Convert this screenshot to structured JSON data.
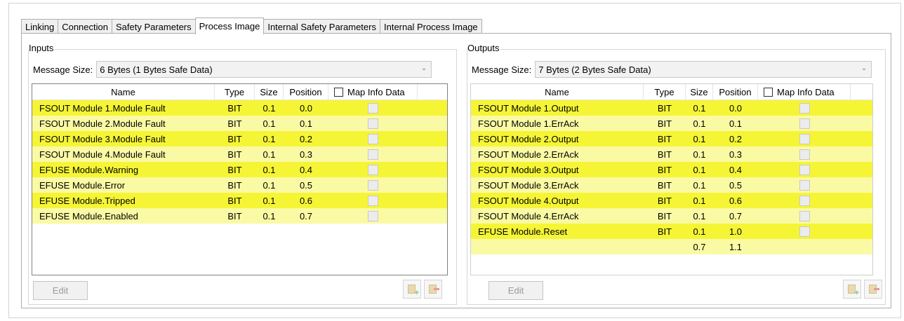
{
  "tabs": [
    "Linking",
    "Connection",
    "Safety Parameters",
    "Process Image",
    "Internal Safety Parameters",
    "Internal Process Image"
  ],
  "active_tab": "Process Image",
  "inputs": {
    "title": "Inputs",
    "message_size_label": "Message Size:",
    "message_size_value": "6 Bytes (1 Bytes Safe Data)",
    "columns": {
      "name": "Name",
      "type": "Type",
      "size": "Size",
      "position": "Position",
      "map_info": "Map Info Data"
    },
    "rows": [
      {
        "name": "FSOUT Module 1.Module Fault",
        "type": "BIT",
        "size": "0.1",
        "position": "0.0"
      },
      {
        "name": "FSOUT Module 2.Module Fault",
        "type": "BIT",
        "size": "0.1",
        "position": "0.1"
      },
      {
        "name": "FSOUT Module 3.Module Fault",
        "type": "BIT",
        "size": "0.1",
        "position": "0.2"
      },
      {
        "name": "FSOUT Module 4.Module Fault",
        "type": "BIT",
        "size": "0.1",
        "position": "0.3"
      },
      {
        "name": "EFUSE Module.Warning",
        "type": "BIT",
        "size": "0.1",
        "position": "0.4"
      },
      {
        "name": "EFUSE Module.Error",
        "type": "BIT",
        "size": "0.1",
        "position": "0.5"
      },
      {
        "name": "EFUSE Module.Tripped",
        "type": "BIT",
        "size": "0.1",
        "position": "0.6"
      },
      {
        "name": "EFUSE Module.Enabled",
        "type": "BIT",
        "size": "0.1",
        "position": "0.7"
      }
    ],
    "edit_label": "Edit"
  },
  "outputs": {
    "title": "Outputs",
    "message_size_label": "Message Size:",
    "message_size_value": "7 Bytes (2 Bytes Safe Data)",
    "columns": {
      "name": "Name",
      "type": "Type",
      "size": "Size",
      "position": "Position",
      "map_info": "Map Info Data"
    },
    "rows": [
      {
        "name": "FSOUT Module 1.Output",
        "type": "BIT",
        "size": "0.1",
        "position": "0.0"
      },
      {
        "name": "FSOUT Module 1.ErrAck",
        "type": "BIT",
        "size": "0.1",
        "position": "0.1"
      },
      {
        "name": "FSOUT Module 2.Output",
        "type": "BIT",
        "size": "0.1",
        "position": "0.2"
      },
      {
        "name": "FSOUT Module 2.ErrAck",
        "type": "BIT",
        "size": "0.1",
        "position": "0.3"
      },
      {
        "name": "FSOUT Module 3.Output",
        "type": "BIT",
        "size": "0.1",
        "position": "0.4"
      },
      {
        "name": "FSOUT Module 3.ErrAck",
        "type": "BIT",
        "size": "0.1",
        "position": "0.5"
      },
      {
        "name": "FSOUT Module 4.Output",
        "type": "BIT",
        "size": "0.1",
        "position": "0.6"
      },
      {
        "name": "FSOUT Module 4.ErrAck",
        "type": "BIT",
        "size": "0.1",
        "position": "0.7"
      },
      {
        "name": "EFUSE Module.Reset",
        "type": "BIT",
        "size": "0.1",
        "position": "1.0"
      },
      {
        "name": "",
        "type": "",
        "size": "0.7",
        "position": "1.1"
      }
    ],
    "edit_label": "Edit"
  },
  "icons": {
    "add": "add-entry-icon",
    "remove": "remove-entry-icon",
    "dropdown": "chevron-down-icon"
  },
  "colors": {
    "row_even": "#f5f536",
    "row_odd": "#fafaa4"
  }
}
